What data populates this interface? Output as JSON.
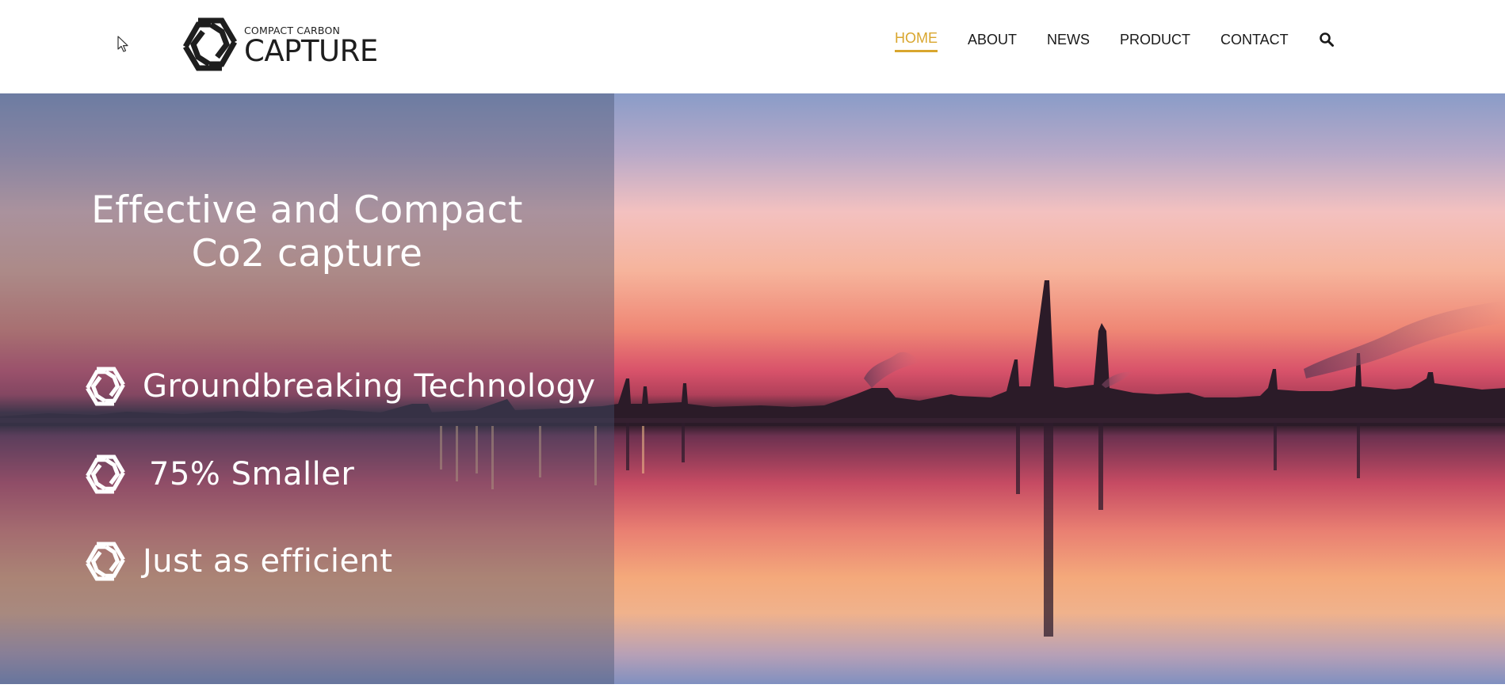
{
  "logo": {
    "small_text": "COMPACT CARBON",
    "big_text": "CAPTURE",
    "icon": "hexagon-knot-logo-icon",
    "color": "#1e1e1e"
  },
  "nav": {
    "items": [
      {
        "label": "HOME",
        "active": true
      },
      {
        "label": "ABOUT",
        "active": false
      },
      {
        "label": "NEWS",
        "active": false
      },
      {
        "label": "PRODUCT",
        "active": false
      },
      {
        "label": "CONTACT",
        "active": false
      }
    ],
    "search_icon": "search-icon",
    "active_color": "#d9a62e",
    "text_color": "#1a1a1a"
  },
  "hero": {
    "title": "Effective and Compact\nCo2 capture",
    "features": [
      {
        "label": "Groundbreaking Technology",
        "icon": "hexagon-knot-icon"
      },
      {
        "label": "75% Smaller",
        "icon": "hexagon-knot-icon"
      },
      {
        "label": "Just as efficient",
        "icon": "hexagon-knot-icon"
      }
    ],
    "background": "sunset-industrial-skyline-over-water",
    "overlay_color": "#46506e"
  }
}
